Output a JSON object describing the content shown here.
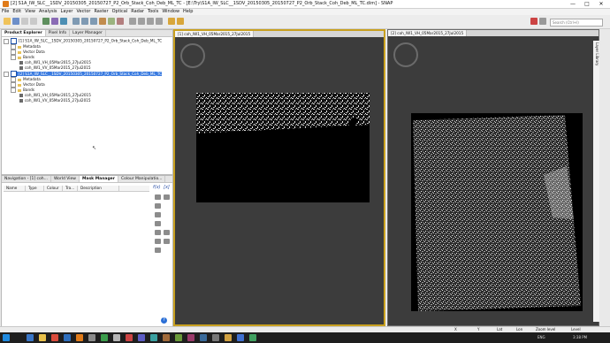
{
  "window": {
    "title": "[2] S1A_IW_SLC__1SDV_20150305_20150727_P2_Orb_Stack_Coh_Deb_ML_TC - [E:\\Try\\S1A_IW_SLC__1SDV_20150305_20150727_P2_Orb_Stack_Coh_Deb_ML_TC.dim] - SNAP",
    "min": "—",
    "max": "□",
    "close": "✕"
  },
  "menu": [
    "File",
    "Edit",
    "View",
    "Analysis",
    "Layer",
    "Vector",
    "Raster",
    "Optical",
    "Radar",
    "Tools",
    "Window",
    "Help"
  ],
  "search": {
    "placeholder": "Search (Ctrl+I)"
  },
  "explorer": {
    "tabs": [
      "Product Explorer",
      "Pixel Info",
      "Layer Manager"
    ],
    "items": [
      {
        "label": "[1] S1A_IW_SLC__1SDV_20150305_20150727_P2_Orb_Stack_Coh_Deb_ML_TC",
        "kind": "product"
      },
      {
        "label": "Metadata",
        "kind": "folder"
      },
      {
        "label": "Vector Data",
        "kind": "folder"
      },
      {
        "label": "Bands",
        "kind": "folder"
      },
      {
        "label": "coh_IW1_VH_05Mar2015_27Jul2015",
        "kind": "band"
      },
      {
        "label": "coh_IW1_VV_05Mar2015_27Jul2015",
        "kind": "band"
      },
      {
        "label": "[2] S1A_IW_SLC__1SDV_20150305_20150727_P2_Orb_Stack_Coh_Deb_ML_TC",
        "kind": "product-selected"
      },
      {
        "label": "Metadata",
        "kind": "folder"
      },
      {
        "label": "Vector Data",
        "kind": "folder"
      },
      {
        "label": "Bands",
        "kind": "folder"
      },
      {
        "label": "coh_IW1_VH_05Mar2015_27Jul2015",
        "kind": "band"
      },
      {
        "label": "coh_IW1_VV_05Mar2015_27Jul2015",
        "kind": "band"
      }
    ]
  },
  "lower_panel": {
    "tabs": [
      "Navigation - [1] coh...",
      "World View",
      "Mask Manager",
      "Colour Manipulatio..."
    ],
    "fx": "f(x)",
    "columns": [
      "Name",
      "Type",
      "Colour",
      "Tra...",
      "Description"
    ]
  },
  "views": {
    "left_tab": "[1] coh_IW1_VH_05Mar2015_27Jul2015",
    "right_tab": "[2] coh_IW1_VH_05Mar2015_27Jul2015"
  },
  "side_label": "Layer Library",
  "statusbar": {
    "x": "X",
    "y": "Y",
    "lat": "Lat",
    "lon": "Lon",
    "zoom": "Zoom level",
    "lvl": "Level"
  },
  "taskbar": {
    "lang": "ENG",
    "time": "3:38 PM"
  },
  "colors": {
    "selection": "#3a7be0",
    "view_bg": "#3c3c3c",
    "focus_border": "#c8a020"
  }
}
